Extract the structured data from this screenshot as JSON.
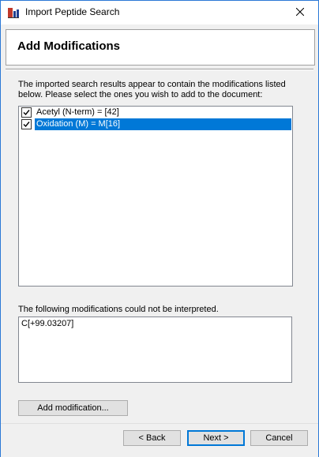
{
  "window": {
    "title": "Import Peptide Search",
    "close_icon": "close-icon",
    "app_icon": "skyline-app-icon"
  },
  "header": {
    "title": "Add Modifications"
  },
  "main": {
    "description": "The imported search results appear to contain the modifications listed below. Please select the ones you wish to add to the document:",
    "modifications": [
      {
        "label": "Acetyl (N-term) = [42]",
        "checked": true,
        "selected": false
      },
      {
        "label": "Oxidation (M) = M[16]",
        "checked": true,
        "selected": true
      }
    ],
    "unrecognized_label": "The following modifications could not be interpreted.",
    "unrecognized_value": "C[+99.03207]",
    "add_modification_button": "Add modification..."
  },
  "footer": {
    "back_button": "< Back",
    "next_button": "Next >",
    "cancel_button": "Cancel"
  },
  "colors": {
    "selection": "#0078d7",
    "window_border": "#2b78d6",
    "background": "#f0f0f0"
  }
}
